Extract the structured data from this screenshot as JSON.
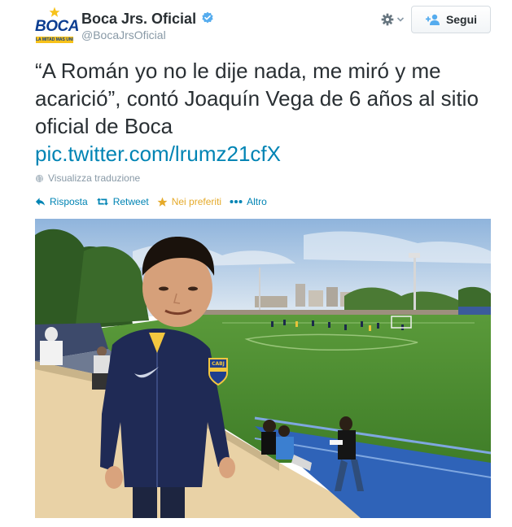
{
  "account": {
    "display_name": "Boca Jrs. Oficial",
    "handle": "@BocaJrsOficial",
    "avatar_wordmark": "BOCA",
    "avatar_band_text": "LA MITAD MAS UNO",
    "verified_icon": "verified-badge-icon",
    "brand_blue": "#0b3d91",
    "brand_gold": "#f7c21a"
  },
  "header": {
    "follow_label": "Segui",
    "gear_icon": "gear-icon"
  },
  "tweet": {
    "text": "“A Román yo no le dije nada, me miró y me acarició”, contó Joaquín Vega de 6 años al sitio oficial de Boca",
    "link": "pic.twitter.com/lrumz21cfX",
    "translate_label": "Visualizza traduzione"
  },
  "actions": {
    "reply": "Risposta",
    "retweet": "Retweet",
    "favorite": "Nei preferiti",
    "more": "Altro",
    "link_color": "#0084b4",
    "favorite_color": "#e5aa2a"
  },
  "photo": {
    "jacket_badge": "CABJ"
  }
}
